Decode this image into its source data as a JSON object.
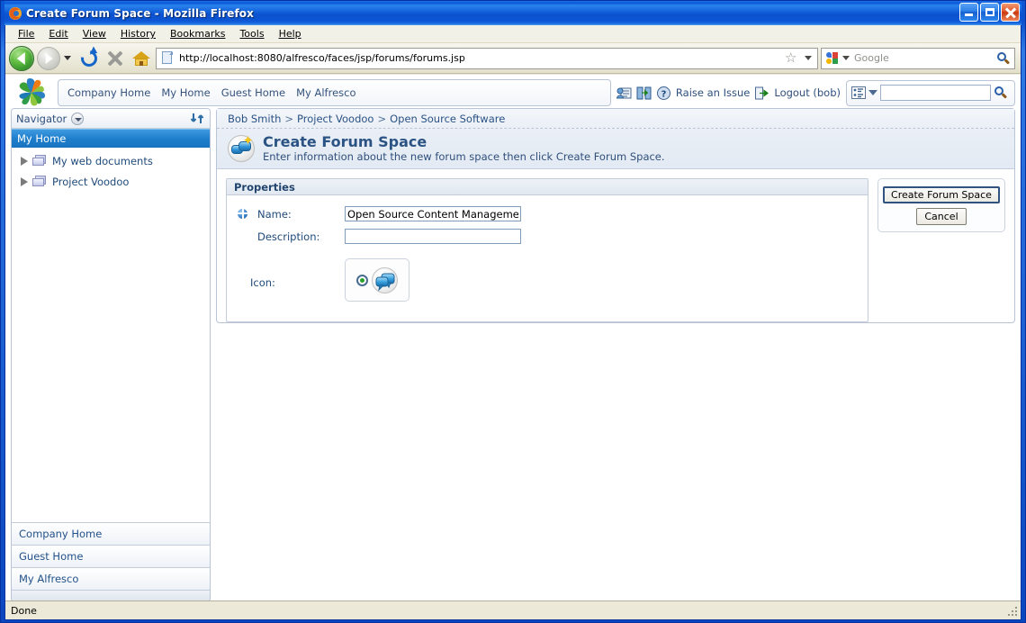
{
  "window": {
    "title": "Create Forum Space - Mozilla Firefox",
    "icon": "firefox-icon",
    "minimize_label": "Minimize",
    "maximize_label": "Maximize",
    "close_label": "Close"
  },
  "menubar": {
    "items": [
      {
        "label": "File"
      },
      {
        "label": "Edit"
      },
      {
        "label": "View"
      },
      {
        "label": "History"
      },
      {
        "label": "Bookmarks"
      },
      {
        "label": "Tools"
      },
      {
        "label": "Help"
      }
    ]
  },
  "toolbar": {
    "back_label": "Back",
    "forward_label": "Forward",
    "reload_label": "Reload",
    "stop_label": "Stop",
    "home_label": "Home",
    "url": "http://localhost:8080/alfresco/faces/jsp/forums/forums.jsp",
    "bookmark_star": "☆",
    "search_engine": "Google",
    "search_value": "",
    "search_placeholder": "Google"
  },
  "app": {
    "logo": "alfresco-logo",
    "shortcuts": [
      {
        "label": "Company Home"
      },
      {
        "label": "My Home"
      },
      {
        "label": "Guest Home"
      },
      {
        "label": "My Alfresco"
      }
    ],
    "tools": {
      "user_profile_icon": "user-profile-icon",
      "migrate_icon": "migrate-icon",
      "help_icon": "help-icon",
      "raise_issue_label": "Raise an Issue",
      "logout_label": "Logout (bob)",
      "logout_icon": "logout-icon"
    },
    "search": {
      "options_icon": "search-options-icon",
      "value": "",
      "placeholder": "",
      "go_icon": "search-icon"
    }
  },
  "sidebar": {
    "header": {
      "title": "Navigator",
      "dropdown_icon": "chevron-down-icon",
      "refresh_icon": "refresh-icon"
    },
    "selected": {
      "label": "My Home"
    },
    "tree": [
      {
        "label": "My web documents",
        "icon": "folder-icon",
        "expander": "collapsed"
      },
      {
        "label": "Project Voodoo",
        "icon": "folder-icon",
        "expander": "collapsed"
      }
    ],
    "links": [
      {
        "label": "Company Home"
      },
      {
        "label": "Guest Home"
      },
      {
        "label": "My Alfresco"
      }
    ]
  },
  "main": {
    "breadcrumb": [
      {
        "label": "Bob Smith"
      },
      {
        "label": "Project Voodoo"
      },
      {
        "label": "Open Source Software"
      }
    ],
    "breadcrumb_separator": ">",
    "title": "Create Forum Space",
    "title_icon": "create-forum-space-icon",
    "subtitle": "Enter information about the new forum space then click Create Forum Space.",
    "properties": {
      "header": "Properties",
      "required_icon": "required-field-icon",
      "fields": [
        {
          "label": "Name:",
          "value": "Open Source Content Management",
          "placeholder": "",
          "required": true
        },
        {
          "label": "Description:",
          "value": "",
          "placeholder": "",
          "required": false
        }
      ],
      "icon_field": {
        "label": "Icon:",
        "selected": true,
        "option_icon": "forum-icon"
      }
    },
    "actions": {
      "primary_label": "Create Forum Space",
      "cancel_label": "Cancel"
    }
  },
  "statusbar": {
    "text": "Done"
  },
  "colors": {
    "titlebar_blue": "#0a57d6",
    "accent_blue": "#2a5285",
    "selected_row": "#1f7fcc",
    "link_blue": "#23528a",
    "panel_border": "#b9c4d6",
    "status_bg": "#ece9d8"
  }
}
